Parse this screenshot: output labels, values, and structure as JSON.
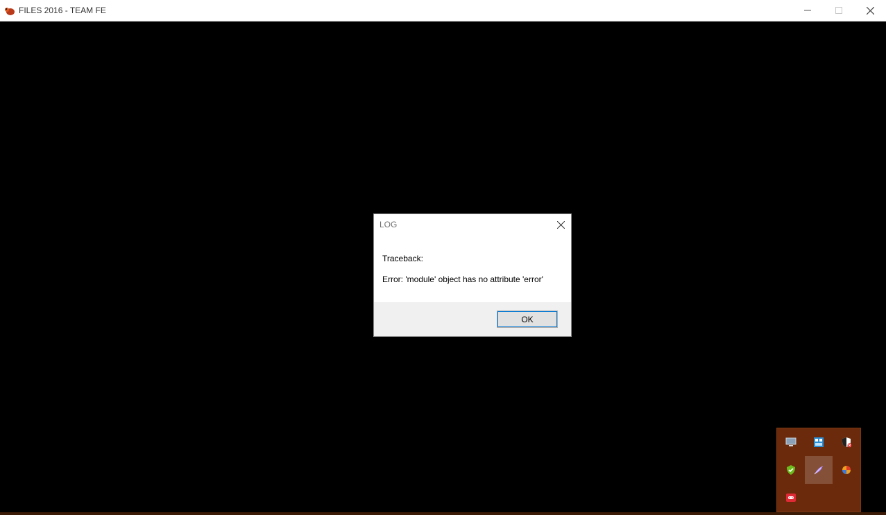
{
  "window": {
    "title": "FILES 2016 - TEAM FE",
    "controls": [
      "minimize-icon",
      "maximize-icon",
      "close-icon"
    ]
  },
  "dialog": {
    "title": "LOG",
    "line1": "Traceback:",
    "line2": "Error: 'module' object has no attribute 'error'",
    "ok_label": "OK"
  },
  "tray": {
    "icons": [
      {
        "name": "display-icon"
      },
      {
        "name": "network-icon"
      },
      {
        "name": "security-shield-icon"
      },
      {
        "name": "shield-check-icon"
      },
      {
        "name": "feather-icon"
      },
      {
        "name": "app-icon"
      },
      {
        "name": "gamepad-icon"
      }
    ]
  },
  "colors": {
    "desktop": "#000000",
    "tray_background": "#6a2a0b",
    "accent": "#0078d7"
  }
}
